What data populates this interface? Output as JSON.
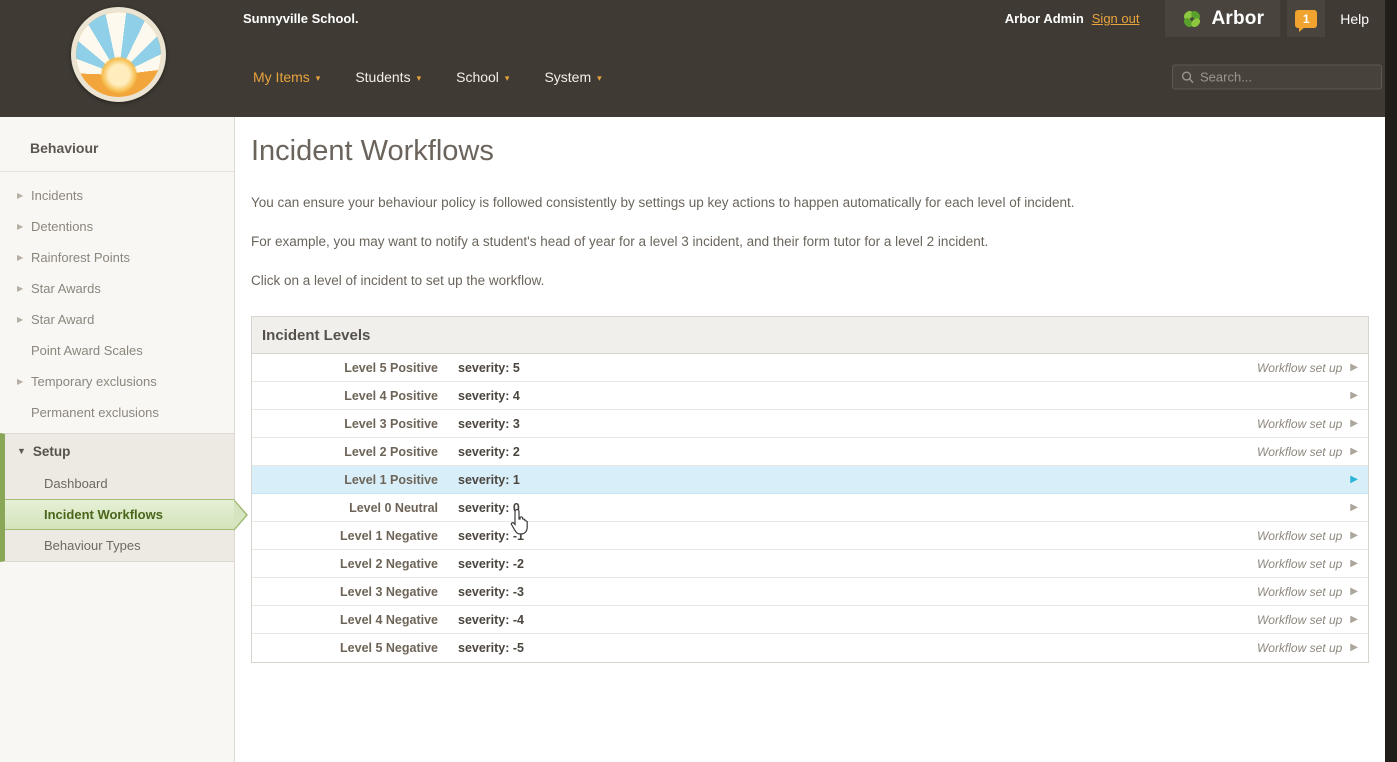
{
  "header": {
    "school_name": "Sunnyville School.",
    "user_label": "Arbor Admin",
    "sign_out_label": "Sign out",
    "brand_label": "Arbor",
    "notification_count": "1",
    "help_label": "Help",
    "search_placeholder": "Search...",
    "nav": [
      {
        "label": "My Items",
        "active": true
      },
      {
        "label": "Students",
        "active": false
      },
      {
        "label": "School",
        "active": false
      },
      {
        "label": "System",
        "active": false
      }
    ]
  },
  "sidebar": {
    "title": "Behaviour",
    "items": [
      {
        "label": "Incidents",
        "arrow": true
      },
      {
        "label": "Detentions",
        "arrow": true
      },
      {
        "label": "Rainforest Points",
        "arrow": true
      },
      {
        "label": "Star Awards",
        "arrow": true
      },
      {
        "label": "Star Award",
        "arrow": true
      },
      {
        "label": "Point Award Scales",
        "arrow": false
      },
      {
        "label": "Temporary exclusions",
        "arrow": true
      },
      {
        "label": "Permanent exclusions",
        "arrow": false
      }
    ],
    "setup": {
      "label": "Setup",
      "items": [
        {
          "label": "Dashboard",
          "selected": false
        },
        {
          "label": "Incident Workflows",
          "selected": true
        },
        {
          "label": "Behaviour Types",
          "selected": false
        }
      ]
    }
  },
  "main": {
    "title": "Incident Workflows",
    "paragraphs": [
      "You can ensure your behaviour policy is followed consistently by settings up key actions to happen automatically for each level of incident.",
      "For example, you may want to notify a student's head of year for a level 3 incident, and their form tutor for a level 2 incident.",
      "Click on a level of incident to set up the workflow."
    ],
    "panel": {
      "title": "Incident Levels",
      "rows": [
        {
          "name": "Level 5 Positive",
          "severity": "severity: 5",
          "status": "Workflow set up",
          "highlighted": false
        },
        {
          "name": "Level 4 Positive",
          "severity": "severity: 4",
          "status": "",
          "highlighted": false
        },
        {
          "name": "Level 3 Positive",
          "severity": "severity: 3",
          "status": "Workflow set up",
          "highlighted": false
        },
        {
          "name": "Level 2 Positive",
          "severity": "severity: 2",
          "status": "Workflow set up",
          "highlighted": false
        },
        {
          "name": "Level 1 Positive",
          "severity": "severity: 1",
          "status": "",
          "highlighted": true
        },
        {
          "name": "Level 0 Neutral",
          "severity": "severity: 0",
          "status": "",
          "highlighted": false
        },
        {
          "name": "Level 1 Negative",
          "severity": "severity: -1",
          "status": "Workflow set up",
          "highlighted": false
        },
        {
          "name": "Level 2 Negative",
          "severity": "severity: -2",
          "status": "Workflow set up",
          "highlighted": false
        },
        {
          "name": "Level 3 Negative",
          "severity": "severity: -3",
          "status": "Workflow set up",
          "highlighted": false
        },
        {
          "name": "Level 4 Negative",
          "severity": "severity: -4",
          "status": "Workflow set up",
          "highlighted": false
        },
        {
          "name": "Level 5 Negative",
          "severity": "severity: -5",
          "status": "Workflow set up",
          "highlighted": false
        }
      ]
    }
  },
  "colors": {
    "header_bg": "#3f3a34",
    "accent_orange": "#e8a33d",
    "brand_green": "#8dc63f",
    "selected_green": "#4a651c",
    "row_highlight": "#d8effa",
    "arrow_teal": "#2bb4d8"
  }
}
